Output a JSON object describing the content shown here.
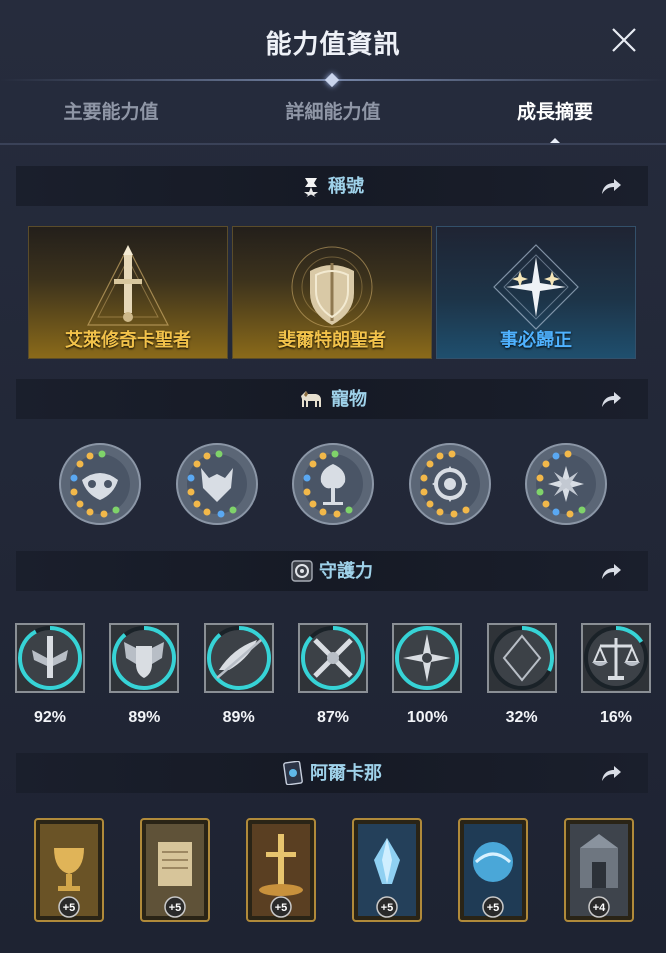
{
  "header": {
    "title": "能力值資訊"
  },
  "tabs": [
    {
      "label": "主要能力值",
      "active": false
    },
    {
      "label": "詳細能力值",
      "active": false
    },
    {
      "label": "成長摘要",
      "active": true
    }
  ],
  "sections": {
    "titles": {
      "label": "稱號",
      "icon": "trophy-icon"
    },
    "pets": {
      "label": "寵物",
      "icon": "horse-icon"
    },
    "guardian": {
      "label": "守護力",
      "icon": "guardian-emblem-icon"
    },
    "arcana": {
      "label": "阿爾卡那",
      "icon": "arcana-card-icon"
    }
  },
  "title_cards": [
    {
      "label": "艾萊修奇卡聖者",
      "style": "gold",
      "icon": "sword-triangle-emblem"
    },
    {
      "label": "斐爾特朗聖者",
      "style": "gold",
      "icon": "shield-emblem"
    },
    {
      "label": "事必歸正",
      "style": "blue",
      "icon": "star-diamond-emblem"
    }
  ],
  "pets": [
    {
      "icon": "owl-mask-medallion"
    },
    {
      "icon": "wolf-mask-medallion"
    },
    {
      "icon": "tree-medallion"
    },
    {
      "icon": "spiral-medallion"
    },
    {
      "icon": "flower-medallion"
    }
  ],
  "guardian": [
    {
      "percent": "92%",
      "value": 0.92,
      "icon": "sword-wings-icon"
    },
    {
      "percent": "89%",
      "value": 0.89,
      "icon": "winged-shield-icon"
    },
    {
      "percent": "89%",
      "value": 0.89,
      "icon": "bird-arrow-icon"
    },
    {
      "percent": "87%",
      "value": 0.87,
      "icon": "crossed-swords-icon"
    },
    {
      "percent": "100%",
      "value": 1.0,
      "icon": "compass-star-icon"
    },
    {
      "percent": "32%",
      "value": 0.32,
      "icon": "crescent-moon-icon"
    },
    {
      "percent": "16%",
      "value": 0.16,
      "icon": "scales-icon"
    }
  ],
  "arcana": [
    {
      "level": "+5",
      "icon": "chalice-card",
      "tint": "gold"
    },
    {
      "level": "+5",
      "icon": "scroll-card",
      "tint": "gold"
    },
    {
      "level": "+5",
      "icon": "cross-sword-card",
      "tint": "gold"
    },
    {
      "level": "+5",
      "icon": "crystal-card",
      "tint": "blue"
    },
    {
      "level": "+5",
      "icon": "orb-card",
      "tint": "blue"
    },
    {
      "level": "+4",
      "icon": "gate-card",
      "tint": "grey"
    }
  ],
  "colors": {
    "accent_cyan": "#37d3d6",
    "title_gold": "#f2c24a",
    "title_blue": "#4fb2ff",
    "section_text": "#9fd2ea"
  }
}
